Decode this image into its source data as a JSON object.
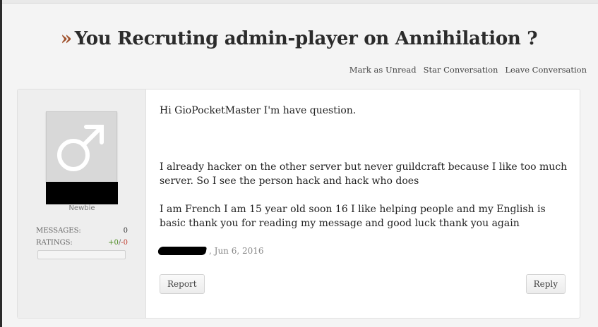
{
  "thread": {
    "title_prefix": "»",
    "title": "You Recruting admin-player on Annihilation ?"
  },
  "actions": {
    "mark_unread": "Mark as Unread",
    "star": "Star Conversation",
    "leave": "Leave Conversation"
  },
  "user": {
    "avatar_icon": "male-symbol-icon",
    "title": "Newbie",
    "stats": {
      "messages_label": "MESSAGES:",
      "messages_value": "0",
      "ratings_label": "RATINGS:",
      "ratings_positive": "+0",
      "ratings_sep": "/",
      "ratings_negative": "-0"
    }
  },
  "message": {
    "paragraph1": "Hi GioPocketMaster I'm have question.",
    "paragraph2": "I already hacker on the other server but never guildcraft because I like too much server. So I see the person hack and hack who does",
    "paragraph3": "I am French I am 15 year old soon 16 I like helping people and my English is basic thank you for reading my message and good luck thank you again",
    "date": ", Jun 6, 2016"
  },
  "buttons": {
    "report": "Report",
    "reply": "Reply"
  },
  "colors": {
    "accent_raquo": "#a0522d",
    "positive": "#4a8a1e",
    "negative": "#c0392b"
  }
}
